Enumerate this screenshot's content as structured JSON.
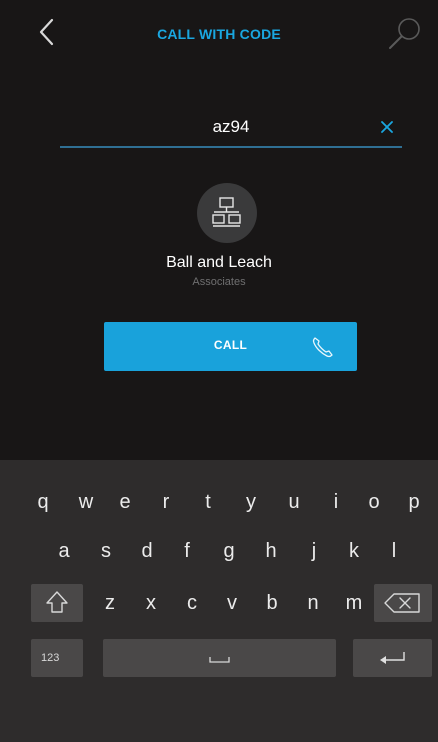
{
  "header": {
    "title": "CALL WITH CODE",
    "back_icon": "chevron-left-icon",
    "search_icon": "search-icon"
  },
  "code_input": {
    "value": "az94",
    "clear_icon": "close-icon"
  },
  "company": {
    "icon": "organization-icon",
    "name": "Ball and Leach",
    "subtitle": "Associates"
  },
  "call_button": {
    "label": "CALL",
    "icon": "phone-icon"
  },
  "keyboard": {
    "row1": [
      "q",
      "w",
      "e",
      "r",
      "t",
      "y",
      "u",
      "i",
      "o",
      "p"
    ],
    "row2": [
      "a",
      "s",
      "d",
      "f",
      "g",
      "h",
      "j",
      "k",
      "l"
    ],
    "row3": [
      "z",
      "x",
      "c",
      "v",
      "b",
      "n",
      "m"
    ],
    "numbers_label": "123",
    "shift_icon": "shift-icon",
    "backspace_icon": "backspace-icon",
    "space_icon": "space-icon",
    "enter_icon": "enter-icon"
  },
  "colors": {
    "accent": "#1aa7e0",
    "button": "#19a2db",
    "background": "#181616",
    "keyboard": "#2e2c2c"
  }
}
